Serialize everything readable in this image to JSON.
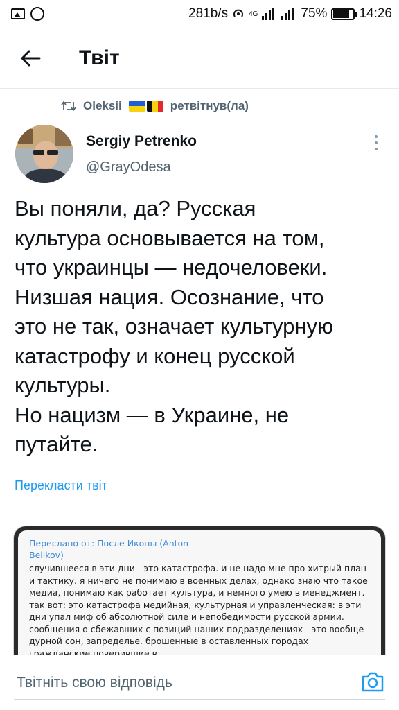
{
  "status_bar": {
    "network_speed": "281b/s",
    "network_type": "4G",
    "battery_percent": "75%",
    "battery_level": 0.75,
    "time": "14:26"
  },
  "header": {
    "back_icon": "arrow-left-icon",
    "title": "Твіт"
  },
  "retweet": {
    "icon": "retweet-icon",
    "user": "Oleksii",
    "flags": [
      "ukraine-flag",
      "belgium-flag"
    ],
    "action": "ретвітнув(ла)"
  },
  "tweet": {
    "author_name": "Sergiy Petrenko",
    "author_handle": "@GrayOdesa",
    "text": "Вы поняли, да? Русская\nкультура основывается на том,\nчто украинцы — недочеловеки.\nНизшая нация. Осознание, что\nэто не так, означает культурную\nкатастрофу и конец русской\nкультуры.\nНо нацизм — в Украине, не\nпутайте.",
    "translate_label": "Перекласти твіт"
  },
  "media": {
    "forwarded_label": "Переслано от: После Иконы (Anton Belikov)",
    "body": "случившееся в эти дни - это катастрофа. и не надо мне про хитрый план и тактику. я ничего не понимаю в военных делах, однако знаю что такое медиа, понимаю как работает культура, и немного умею в менеджмент. так вот: это катастрофа медийная, культурная и управленческая: в эти дни упал миф об абсолютной силе и непобедимости русской армии. сообщения о сбежавших с позиций наших подразделениях - это вообще дурной сон, запределье. брошенные в оставленных городах гражданские поверившие в"
  },
  "reply": {
    "placeholder": "Твітніть свою відповідь",
    "camera_icon": "camera-icon"
  },
  "colors": {
    "accent": "#1d9bf0",
    "text_primary": "#0f1419",
    "text_secondary": "#536471",
    "divider": "#e7e9ea"
  }
}
